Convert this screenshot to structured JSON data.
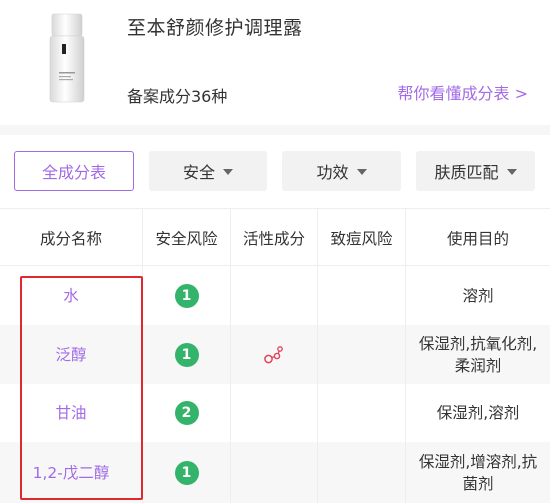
{
  "product": {
    "name": "至本舒颜修护调理露",
    "ingredient_count": "备案成分36种",
    "help_link": "帮你看懂成分表 >"
  },
  "filters": [
    {
      "label": "全成分表",
      "active": true
    },
    {
      "label": "安全",
      "active": false
    },
    {
      "label": "功效",
      "active": false
    },
    {
      "label": "肤质匹配",
      "active": false
    }
  ],
  "table": {
    "headers": [
      "成分名称",
      "安全风险",
      "活性成分",
      "致痘风险",
      "使用目的"
    ],
    "rows": [
      {
        "name": "水",
        "safety": "1",
        "active": "",
        "acne": "",
        "purpose": "溶剂"
      },
      {
        "name": "泛醇",
        "safety": "1",
        "active": "active-ingredient-icon",
        "acne": "",
        "purpose": "保湿剂,抗氧化剂,柔润剂"
      },
      {
        "name": "甘油",
        "safety": "2",
        "active": "",
        "acne": "",
        "purpose": "保湿剂,溶剂"
      },
      {
        "name": "1,2-戊二醇",
        "safety": "1",
        "active": "",
        "acne": "",
        "purpose": "保湿剂,增溶剂,抗菌剂"
      }
    ]
  },
  "colors": {
    "accent": "#a26be6",
    "safety_badge": "#34b36a",
    "highlight_box": "#e0292f",
    "active_icon": "#e0455a"
  }
}
